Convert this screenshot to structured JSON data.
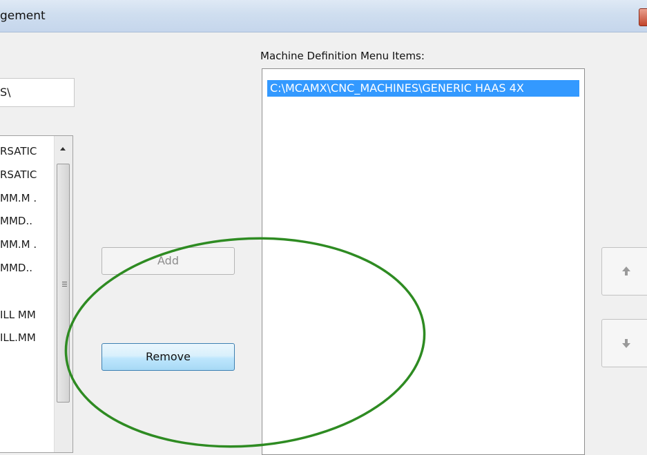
{
  "window": {
    "title": "gement",
    "close_icon": "close-icon"
  },
  "left_panel": {
    "path_value": "S\\",
    "file_items": [
      "RSATIC",
      "RSATIC",
      ". MM.M",
      "..MMD",
      ". MM.M",
      "..MMD",
      "",
      "ILL MM",
      "ILL.MM"
    ]
  },
  "buttons": {
    "add_label": "Add",
    "remove_label": "Remove"
  },
  "menu_items": {
    "label": "Machine Definition Menu Items:",
    "selected_item": "C:\\MCAMX\\CNC_MACHINES\\GENERIC HAAS 4X"
  },
  "side_buttons": {
    "up_icon": "arrow-up-icon",
    "down_icon": "arrow-down-icon"
  },
  "colors": {
    "selection": "#3399ff",
    "annotation_ellipse": "#2e8b22"
  }
}
